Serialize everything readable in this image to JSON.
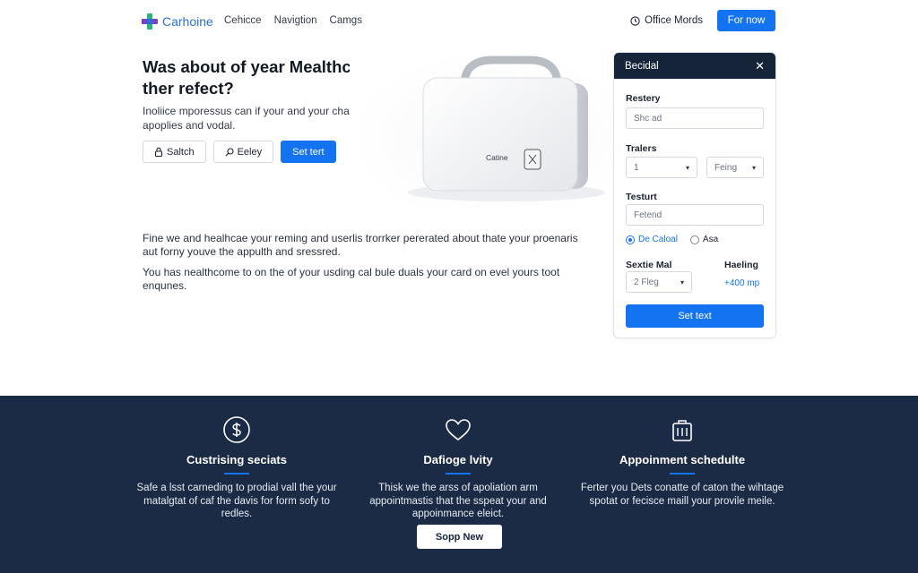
{
  "nav": {
    "logo_text": "Carhoine",
    "links": [
      "Cehicce",
      "Navigtion",
      "Camgs"
    ],
    "office_label": "Office Mords",
    "cta_label": "For now"
  },
  "hero": {
    "title": "Was about of year Mealthcare in ther refect?",
    "description": "Inoliice mporessus can if your and your chal gare apoplies and vodal.",
    "buttons": {
      "switch_label": "Saltch",
      "easy_label": "Eeley",
      "primary_label": "Set tert"
    }
  },
  "product": {
    "label": "Catine"
  },
  "body": {
    "paragraph1": "Fine we and healhcae your reming and userlis trorrker pererated about thate your proenaris aut forny youve the appulth and sressred.",
    "paragraph2": "You has nealthcome to on the of your usding cal bule duals your card on evel yours toot enqunes."
  },
  "panel": {
    "title": "Becidal",
    "fields": {
      "restery_label": "Restery",
      "restery_value": "Shc ad",
      "trailers_label": "Tralers",
      "trailers_select1": "1",
      "trailers_select2": "Feing",
      "testurt_label": "Testurt",
      "testurt_value": "Fetend",
      "radio1": "De Caloal",
      "radio2": "Asa",
      "sextie_label": "Sextie Mal",
      "sextie_value": "2 Fleg",
      "heading_label": "Haeling",
      "heading_value": "+400 mp"
    },
    "submit_label": "Set text"
  },
  "features": [
    {
      "title": "Custrising seciats",
      "desc": "Safe a lsst carneding to prodial vall the your matalgtat of caf the davis for form sofy to redles."
    },
    {
      "title": "Dafioge lvity",
      "desc": "Thisk we the arss of apoliation arm appointmastis that the sspeat your and appoinmance eleict."
    },
    {
      "title": "Appoinment schedulte",
      "desc": "Ferter you Dets conatte of caton the wihtage spotat or fecisce maill your provile meile."
    }
  ],
  "band_button": "Sopp New",
  "colors": {
    "accent": "#1473f0",
    "band": "#1b2b45",
    "panel_head": "#16243a"
  }
}
